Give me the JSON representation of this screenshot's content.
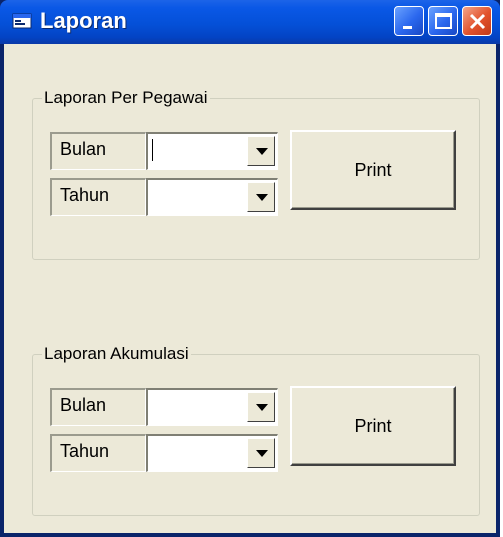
{
  "window": {
    "title": "Laporan"
  },
  "group_per_pegawai": {
    "legend": "Laporan Per Pegawai",
    "bulan_label": "Bulan",
    "bulan_value": "",
    "tahun_label": "Tahun",
    "tahun_value": "",
    "print_label": "Print"
  },
  "group_akumulasi": {
    "legend": "Laporan Akumulasi",
    "bulan_label": "Bulan",
    "bulan_value": "",
    "tahun_label": "Tahun",
    "tahun_value": "",
    "print_label": "Print"
  },
  "colors": {
    "titlebar": "#0450d8",
    "close_button": "#e2522c",
    "face": "#ece9d8"
  },
  "icons": [
    "window-app-icon",
    "minimize-icon",
    "maximize-icon",
    "close-icon",
    "dropdown-arrow-icon"
  ]
}
